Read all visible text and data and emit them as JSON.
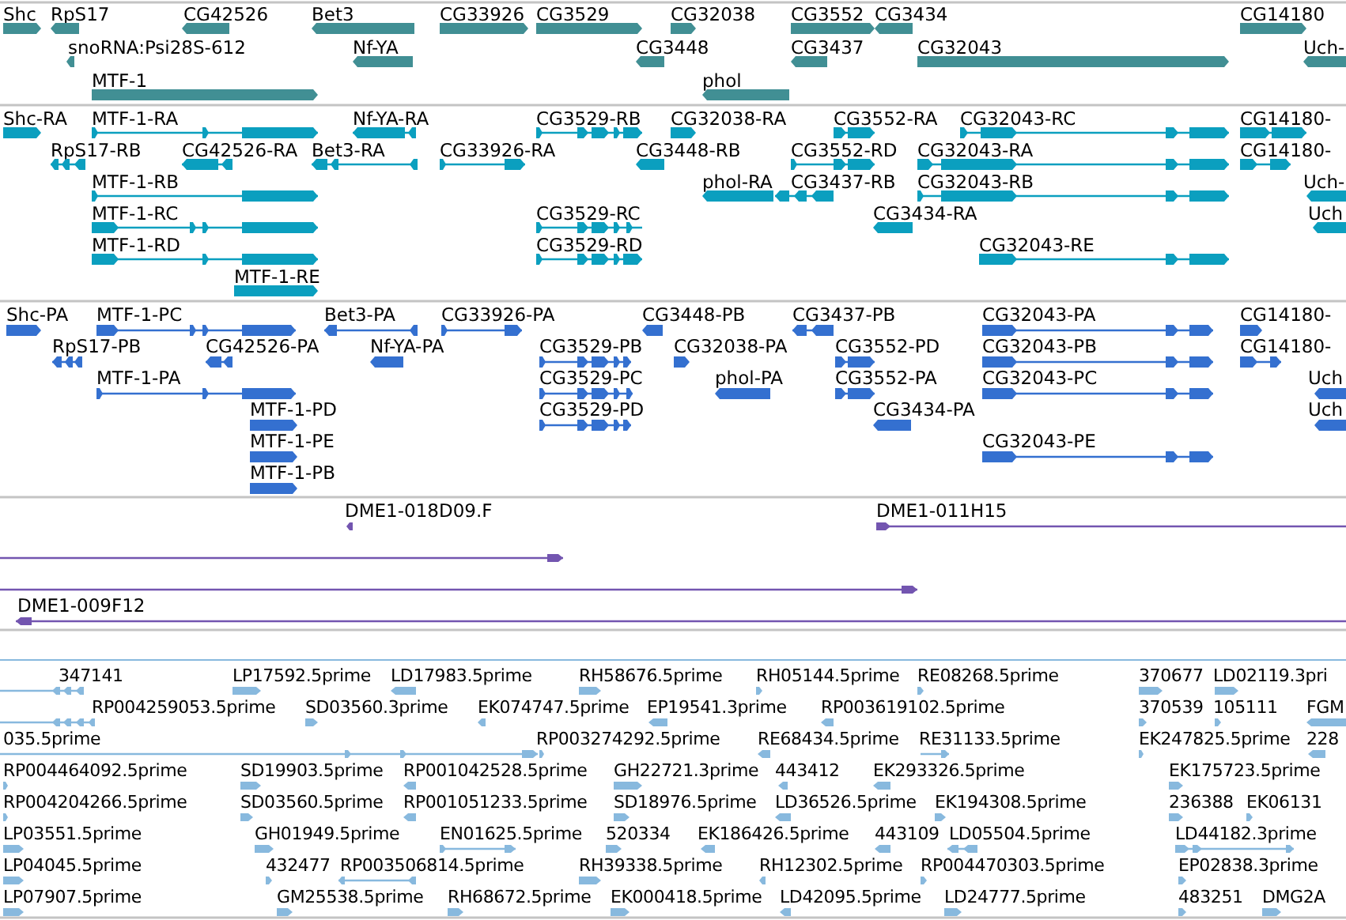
{
  "tracks": [
    {
      "kind": "gene",
      "color": "#418f94",
      "features": [
        {
          "label": "Shc",
          "reverse": false
        },
        {
          "label": "RpS17",
          "reverse": true
        },
        {
          "label": "CG42526",
          "reverse": true
        },
        {
          "label": "Bet3",
          "reverse": true
        },
        {
          "label": "CG33926",
          "reverse": false
        },
        {
          "label": "CG3529",
          "reverse": false
        },
        {
          "label": "CG32038",
          "reverse": false
        },
        {
          "label": "CG3552",
          "reverse": false
        },
        {
          "label": "CG3434",
          "reverse": true
        },
        {
          "label": "CG14180",
          "reverse": false
        },
        {
          "label": "snoRNA:Psi28S-612",
          "reverse": true
        },
        {
          "label": "Nf-YA",
          "reverse": true
        },
        {
          "label": "CG3448",
          "reverse": true
        },
        {
          "label": "CG3437",
          "reverse": true
        },
        {
          "label": "CG32043",
          "reverse": false
        },
        {
          "label": "Uch-",
          "reverse": true
        },
        {
          "label": "MTF-1",
          "reverse": false
        },
        {
          "label": "phol",
          "reverse": true
        }
      ]
    },
    {
      "kind": "transcript",
      "color": "#0b9fbf",
      "features": [
        {
          "label": "Shc-RA",
          "reverse": false
        },
        {
          "label": "MTF-1-RA",
          "reverse": false
        },
        {
          "label": "Nf-YA-RA",
          "reverse": true
        },
        {
          "label": "CG3529-RB",
          "reverse": false
        },
        {
          "label": "CG32038-RA",
          "reverse": false
        },
        {
          "label": "CG3552-RA",
          "reverse": false
        },
        {
          "label": "CG32043-RC",
          "reverse": false
        },
        {
          "label": "CG14180-",
          "reverse": false
        },
        {
          "label": "RpS17-RB",
          "reverse": true
        },
        {
          "label": "CG42526-RA",
          "reverse": true
        },
        {
          "label": "Bet3-RA",
          "reverse": true
        },
        {
          "label": "CG33926-RA",
          "reverse": false
        },
        {
          "label": "CG3448-RB",
          "reverse": true
        },
        {
          "label": "CG3552-RD",
          "reverse": false
        },
        {
          "label": "CG32043-RA",
          "reverse": false
        },
        {
          "label": "CG14180-",
          "reverse": false
        },
        {
          "label": "MTF-1-RB",
          "reverse": false
        },
        {
          "label": "phol-RA",
          "reverse": true
        },
        {
          "label": "CG3437-RB",
          "reverse": true
        },
        {
          "label": "CG32043-RB",
          "reverse": false
        },
        {
          "label": "Uch-",
          "reverse": true
        },
        {
          "label": "MTF-1-RC",
          "reverse": false
        },
        {
          "label": "CG3529-RC",
          "reverse": false
        },
        {
          "label": "CG3434-RA",
          "reverse": true
        },
        {
          "label": "Uch",
          "reverse": true
        },
        {
          "label": "MTF-1-RD",
          "reverse": false
        },
        {
          "label": "CG3529-RD",
          "reverse": false
        },
        {
          "label": "CG32043-RE",
          "reverse": false
        },
        {
          "label": "MTF-1-RE",
          "reverse": false
        }
      ]
    },
    {
      "kind": "protein",
      "color": "#3470d0",
      "features": [
        {
          "label": "Shc-PA",
          "reverse": false
        },
        {
          "label": "MTF-1-PC",
          "reverse": false
        },
        {
          "label": "Bet3-PA",
          "reverse": true
        },
        {
          "label": "CG33926-PA",
          "reverse": false
        },
        {
          "label": "CG3448-PB",
          "reverse": true
        },
        {
          "label": "CG3437-PB",
          "reverse": true
        },
        {
          "label": "CG32043-PA",
          "reverse": false
        },
        {
          "label": "CG14180-",
          "reverse": false
        },
        {
          "label": "RpS17-PB",
          "reverse": true
        },
        {
          "label": "CG42526-PA",
          "reverse": true
        },
        {
          "label": "Nf-YA-PA",
          "reverse": true
        },
        {
          "label": "CG3529-PB",
          "reverse": false
        },
        {
          "label": "CG32038-PA",
          "reverse": false
        },
        {
          "label": "CG3552-PD",
          "reverse": false
        },
        {
          "label": "CG32043-PB",
          "reverse": false
        },
        {
          "label": "CG14180-",
          "reverse": false
        },
        {
          "label": "MTF-1-PA",
          "reverse": false
        },
        {
          "label": "CG3529-PC",
          "reverse": false
        },
        {
          "label": "phol-PA",
          "reverse": true
        },
        {
          "label": "CG3552-PA",
          "reverse": false
        },
        {
          "label": "CG32043-PC",
          "reverse": false
        },
        {
          "label": "Uch",
          "reverse": true
        },
        {
          "label": "MTF-1-PD",
          "reverse": false
        },
        {
          "label": "CG3529-PD",
          "reverse": false
        },
        {
          "label": "CG3434-PA",
          "reverse": true
        },
        {
          "label": "Uch",
          "reverse": true
        },
        {
          "label": "MTF-1-PE",
          "reverse": false
        },
        {
          "label": "CG32043-PE",
          "reverse": false
        },
        {
          "label": "MTF-1-PB",
          "reverse": false
        }
      ]
    },
    {
      "kind": "clone",
      "color": "#7355b0",
      "features": [
        {
          "label": "DME1-018D09.F",
          "reverse": true
        },
        {
          "label": "DME1-011H15",
          "reverse": false
        },
        {
          "reverse": false
        },
        {
          "reverse": false
        },
        {
          "label": "DME1-009F12",
          "reverse": true
        }
      ]
    },
    {
      "kind": "est",
      "color": "#88b9de",
      "features": [
        {
          "label": "347141",
          "reverse": true
        },
        {
          "label": "LP17592.5prime",
          "reverse": false
        },
        {
          "label": "LD17983.5prime",
          "reverse": true
        },
        {
          "label": "RH58676.5prime",
          "reverse": false
        },
        {
          "label": "RH05144.5prime",
          "reverse": false
        },
        {
          "label": "RE08268.5prime",
          "reverse": false
        },
        {
          "label": "370677",
          "reverse": false
        },
        {
          "label": "LD02119.3pri",
          "reverse": false
        },
        {
          "label": "RP004259053.5prime",
          "reverse": true
        },
        {
          "label": "SD03560.3prime",
          "reverse": false
        },
        {
          "label": "EK074747.5prime",
          "reverse": true
        },
        {
          "label": "EP19541.3prime",
          "reverse": true
        },
        {
          "label": "RP003619102.5prime",
          "reverse": true
        },
        {
          "label": "370539",
          "reverse": false
        },
        {
          "label": "105111",
          "reverse": false
        },
        {
          "label": "FGM",
          "reverse": true
        },
        {
          "label": "035.5prime",
          "reverse": false
        },
        {
          "label": "RP003274292.5prime",
          "reverse": false
        },
        {
          "label": "RE68434.5prime",
          "reverse": true
        },
        {
          "label": "RE31133.5prime",
          "reverse": false
        },
        {
          "label": "EK247825.5prime",
          "reverse": false
        },
        {
          "label": "228",
          "reverse": true
        },
        {
          "label": "RP004464092.5prime",
          "reverse": false
        },
        {
          "label": "SD19903.5prime",
          "reverse": false
        },
        {
          "label": "RP001042528.5prime",
          "reverse": true
        },
        {
          "label": "GH22721.3prime",
          "reverse": false
        },
        {
          "label": "443412",
          "reverse": true
        },
        {
          "label": "EK293326.5prime",
          "reverse": true
        },
        {
          "label": "EK175723.5prime",
          "reverse": false
        },
        {
          "label": "RP004204266.5prime",
          "reverse": false
        },
        {
          "label": "SD03560.5prime",
          "reverse": false
        },
        {
          "label": "RP001051233.5prime",
          "reverse": true
        },
        {
          "label": "SD18976.5prime",
          "reverse": false
        },
        {
          "label": "LD36526.5prime",
          "reverse": true
        },
        {
          "label": "EK194308.5prime",
          "reverse": false
        },
        {
          "label": "236388",
          "reverse": false
        },
        {
          "label": "EK06131",
          "reverse": false
        },
        {
          "label": "LP03551.5prime",
          "reverse": false
        },
        {
          "label": "GH01949.5prime",
          "reverse": false
        },
        {
          "label": "EN01625.5prime",
          "reverse": false
        },
        {
          "label": "520334",
          "reverse": false
        },
        {
          "label": "EK186426.5prime",
          "reverse": true
        },
        {
          "label": "443109",
          "reverse": true
        },
        {
          "label": "LD05504.5prime",
          "reverse": true
        },
        {
          "label": "LD44182.3prime",
          "reverse": false
        },
        {
          "label": "LP04045.5prime",
          "reverse": false
        },
        {
          "label": "432477",
          "reverse": false
        },
        {
          "label": "RP003506814.5prime",
          "reverse": true
        },
        {
          "label": "RH39338.5prime",
          "reverse": false
        },
        {
          "label": "RH12302.5prime",
          "reverse": true
        },
        {
          "label": "RP004470303.5prime",
          "reverse": false
        },
        {
          "label": "EP02838.3prime",
          "reverse": false
        },
        {
          "label": "LP07907.5prime",
          "reverse": false
        },
        {
          "label": "GM25538.5prime",
          "reverse": false
        },
        {
          "label": "RH68672.5prime",
          "reverse": false
        },
        {
          "label": "EK000418.5prime",
          "reverse": false
        },
        {
          "label": "LD42095.5prime",
          "reverse": true
        },
        {
          "label": "LD24777.5prime",
          "reverse": false
        },
        {
          "label": "483251",
          "reverse": false
        },
        {
          "label": "DMG2A",
          "reverse": false
        }
      ]
    }
  ]
}
